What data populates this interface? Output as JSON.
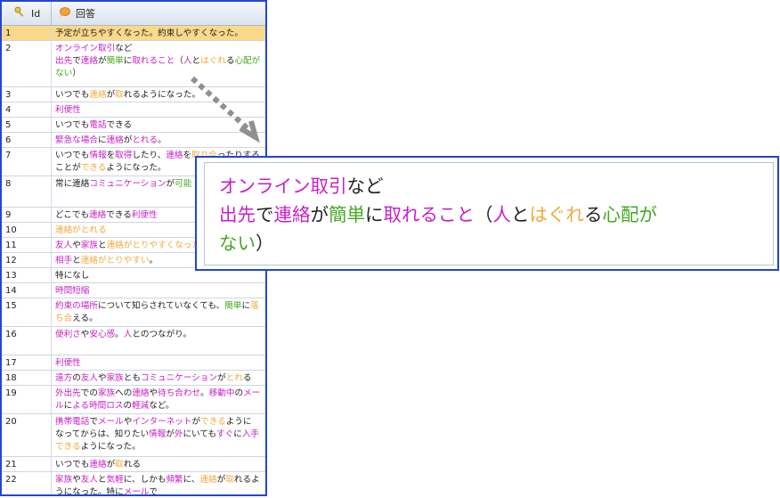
{
  "header": {
    "id_label": "Id",
    "answer_label": "回答",
    "id_icon": "key-icon",
    "answer_icon": "speech-bubble-icon"
  },
  "colors": {
    "magenta": "#c81ec8",
    "orange": "#f2a93b",
    "green": "#43a81f",
    "selected_row": "#fbd98a",
    "border": "#2146d6"
  },
  "rows": [
    {
      "id": "1",
      "h": 17,
      "selected": true,
      "parts": [
        [
          "予定が立ちやすくなった。約束しやすくなった。",
          "black"
        ]
      ]
    },
    {
      "id": "2",
      "h": 52,
      "parts": [
        [
          "オンライン取引",
          "magenta"
        ],
        [
          "など",
          "black"
        ],
        [
          "\n",
          "br"
        ],
        [
          "出先",
          "magenta"
        ],
        [
          "で",
          "black"
        ],
        [
          "連絡",
          "magenta"
        ],
        [
          "が",
          "black"
        ],
        [
          "簡単",
          "green"
        ],
        [
          "に",
          "black"
        ],
        [
          "取れること",
          "magenta"
        ],
        [
          "（",
          "black"
        ],
        [
          "人",
          "magenta"
        ],
        [
          "と",
          "black"
        ],
        [
          "はぐれ",
          "orange"
        ],
        [
          "る",
          "black"
        ],
        [
          "心配が",
          "green"
        ],
        [
          "\n",
          "br"
        ],
        [
          "ない",
          "green"
        ],
        [
          "）",
          "black"
        ]
      ]
    },
    {
      "id": "3",
      "h": 17,
      "parts": [
        [
          "いつでも",
          "black"
        ],
        [
          "連絡",
          "orange"
        ],
        [
          "が",
          "black"
        ],
        [
          "取",
          "orange"
        ],
        [
          "れるようになった。",
          "black"
        ]
      ]
    },
    {
      "id": "4",
      "h": 17,
      "parts": [
        [
          "利便性",
          "magenta"
        ]
      ]
    },
    {
      "id": "5",
      "h": 17,
      "parts": [
        [
          "いつでも",
          "black"
        ],
        [
          "電話",
          "magenta"
        ],
        [
          "できる",
          "black"
        ]
      ]
    },
    {
      "id": "6",
      "h": 17,
      "parts": [
        [
          "緊急な場合",
          "magenta"
        ],
        [
          "に",
          "black"
        ],
        [
          "連絡",
          "magenta"
        ],
        [
          "が",
          "black"
        ],
        [
          "とれる",
          "magenta"
        ],
        [
          "。",
          "black"
        ]
      ]
    },
    {
      "id": "7",
      "h": 32,
      "parts": [
        [
          "いつでも",
          "black"
        ],
        [
          "情報",
          "magenta"
        ],
        [
          "を",
          "black"
        ],
        [
          "取得",
          "magenta"
        ],
        [
          "したり、",
          "black"
        ],
        [
          "連絡",
          "magenta"
        ],
        [
          "を",
          "black"
        ],
        [
          "取り合",
          "orange"
        ],
        [
          "ったりする",
          "black"
        ],
        [
          "\n",
          "br"
        ],
        [
          "ことが",
          "black"
        ],
        [
          "できる",
          "orange"
        ],
        [
          "ようになった。",
          "black"
        ]
      ]
    },
    {
      "id": "8",
      "h": 35,
      "parts": [
        [
          "常に連絡",
          "black"
        ],
        [
          "コミュニケーション",
          "magenta"
        ],
        [
          "が",
          "black"
        ],
        [
          "可能",
          "green"
        ]
      ]
    },
    {
      "id": "9",
      "h": 17,
      "parts": [
        [
          "どこでも",
          "black"
        ],
        [
          "連絡",
          "magenta"
        ],
        [
          "できる",
          "black"
        ],
        [
          "利便性",
          "magenta"
        ]
      ]
    },
    {
      "id": "10",
      "h": 17,
      "parts": [
        [
          "連絡がとれる",
          "orange"
        ]
      ]
    },
    {
      "id": "11",
      "h": 17,
      "parts": [
        [
          "友人",
          "magenta"
        ],
        [
          "や",
          "black"
        ],
        [
          "家族",
          "magenta"
        ],
        [
          "と",
          "black"
        ],
        [
          "連絡がとりやすくなった",
          "orange"
        ]
      ]
    },
    {
      "id": "12",
      "h": 17,
      "parts": [
        [
          "相手",
          "magenta"
        ],
        [
          "と",
          "black"
        ],
        [
          "連絡がとりやすい",
          "orange"
        ],
        [
          "。",
          "black"
        ]
      ]
    },
    {
      "id": "13",
      "h": 17,
      "parts": [
        [
          "特になし",
          "black"
        ]
      ]
    },
    {
      "id": "14",
      "h": 17,
      "parts": [
        [
          "時間短縮",
          "magenta"
        ]
      ]
    },
    {
      "id": "15",
      "h": 32,
      "parts": [
        [
          "約束の場所",
          "magenta"
        ],
        [
          "について知らされていなくても、",
          "black"
        ],
        [
          "簡単",
          "green"
        ],
        [
          "に",
          "black"
        ],
        [
          "落",
          "orange"
        ],
        [
          "\n",
          "br"
        ],
        [
          "ち合",
          "orange"
        ],
        [
          "える。",
          "black"
        ]
      ]
    },
    {
      "id": "16",
      "h": 32,
      "parts": [
        [
          "便利さ",
          "magenta"
        ],
        [
          "や",
          "black"
        ],
        [
          "安心感",
          "magenta"
        ],
        [
          "。",
          "black"
        ],
        [
          "人",
          "magenta"
        ],
        [
          "とのつながり。",
          "black"
        ]
      ]
    },
    {
      "id": "17",
      "h": 17,
      "parts": [
        [
          "利便性",
          "magenta"
        ]
      ]
    },
    {
      "id": "18",
      "h": 17,
      "parts": [
        [
          "遠方",
          "magenta"
        ],
        [
          "の",
          "black"
        ],
        [
          "友人",
          "magenta"
        ],
        [
          "や",
          "black"
        ],
        [
          "家族",
          "magenta"
        ],
        [
          "とも",
          "black"
        ],
        [
          "コミュニケーション",
          "magenta"
        ],
        [
          "が",
          "black"
        ],
        [
          "とれ",
          "orange"
        ],
        [
          "る",
          "black"
        ]
      ]
    },
    {
      "id": "19",
      "h": 32,
      "parts": [
        [
          "外出先",
          "magenta"
        ],
        [
          "での",
          "black"
        ],
        [
          "家族",
          "magenta"
        ],
        [
          "への",
          "black"
        ],
        [
          "連絡",
          "magenta"
        ],
        [
          "や",
          "black"
        ],
        [
          "待ち合わせ",
          "magenta"
        ],
        [
          "。",
          "black"
        ],
        [
          "移動中",
          "magenta"
        ],
        [
          "の",
          "black"
        ],
        [
          "メー",
          "magenta"
        ],
        [
          "\n",
          "br"
        ],
        [
          "ル",
          "magenta"
        ],
        [
          "に",
          "black"
        ],
        [
          "よる",
          "magenta"
        ],
        [
          "時間ロス",
          "magenta"
        ],
        [
          "の",
          "black"
        ],
        [
          "軽減",
          "magenta"
        ],
        [
          "など。",
          "black"
        ]
      ]
    },
    {
      "id": "20",
      "h": 48,
      "parts": [
        [
          "携帯電話",
          "magenta"
        ],
        [
          "で",
          "black"
        ],
        [
          "メール",
          "magenta"
        ],
        [
          "や",
          "black"
        ],
        [
          "インターネット",
          "magenta"
        ],
        [
          "が",
          "black"
        ],
        [
          "できる",
          "orange"
        ],
        [
          "ように",
          "black"
        ],
        [
          "\n",
          "br"
        ],
        [
          "なってからは、知りたい",
          "black"
        ],
        [
          "情報",
          "magenta"
        ],
        [
          "が",
          "black"
        ],
        [
          "外",
          "magenta"
        ],
        [
          "にいても",
          "black"
        ],
        [
          "すぐ",
          "magenta"
        ],
        [
          "に",
          "black"
        ],
        [
          "入手",
          "magenta"
        ],
        [
          "\n",
          "br"
        ],
        [
          "できる",
          "orange"
        ],
        [
          "ようになった。",
          "black"
        ]
      ]
    },
    {
      "id": "21",
      "h": 17,
      "parts": [
        [
          "いつでも",
          "black"
        ],
        [
          "連絡",
          "magenta"
        ],
        [
          "が",
          "black"
        ],
        [
          "取",
          "orange"
        ],
        [
          "れる",
          "black"
        ]
      ]
    },
    {
      "id": "22",
      "h": 30,
      "parts": [
        [
          "家族",
          "magenta"
        ],
        [
          "や",
          "black"
        ],
        [
          "友人",
          "magenta"
        ],
        [
          "と",
          "black"
        ],
        [
          "気軽",
          "magenta"
        ],
        [
          "に、しかも",
          "black"
        ],
        [
          "頻繁",
          "magenta"
        ],
        [
          "に、",
          "black"
        ],
        [
          "連絡",
          "orange"
        ],
        [
          "が",
          "black"
        ],
        [
          "取",
          "orange"
        ],
        [
          "れるよ",
          "black"
        ],
        [
          "\n",
          "br"
        ],
        [
          "うになった。特に",
          "black"
        ],
        [
          "メール",
          "magenta"
        ],
        [
          "で",
          "black"
        ]
      ]
    }
  ],
  "zoom": {
    "parts": [
      [
        "オンライン取引",
        "magenta"
      ],
      [
        "など",
        "black"
      ],
      [
        "\n",
        "br"
      ],
      [
        "出先",
        "magenta"
      ],
      [
        "で",
        "black"
      ],
      [
        "連絡",
        "magenta"
      ],
      [
        "が",
        "black"
      ],
      [
        "簡単",
        "green"
      ],
      [
        "に",
        "black"
      ],
      [
        "取れること",
        "magenta"
      ],
      [
        "（",
        "black"
      ],
      [
        "人",
        "magenta"
      ],
      [
        "と",
        "black"
      ],
      [
        "はぐれ",
        "orange"
      ],
      [
        "る",
        "black"
      ],
      [
        "心配が",
        "green"
      ],
      [
        "\n",
        "br"
      ],
      [
        "ない",
        "green"
      ],
      [
        "）",
        "black"
      ]
    ]
  }
}
